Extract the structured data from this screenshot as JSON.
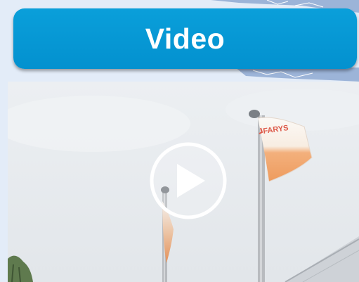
{
  "header": {
    "title": "Video"
  },
  "video": {
    "flag_logo_text": "FARYS",
    "play_icon": "play-circle-icon"
  },
  "colors": {
    "banner": "#0a9fda",
    "title_text": "#ffffff",
    "background": "#e2ebf7",
    "flag_orange": "#f0a770"
  }
}
